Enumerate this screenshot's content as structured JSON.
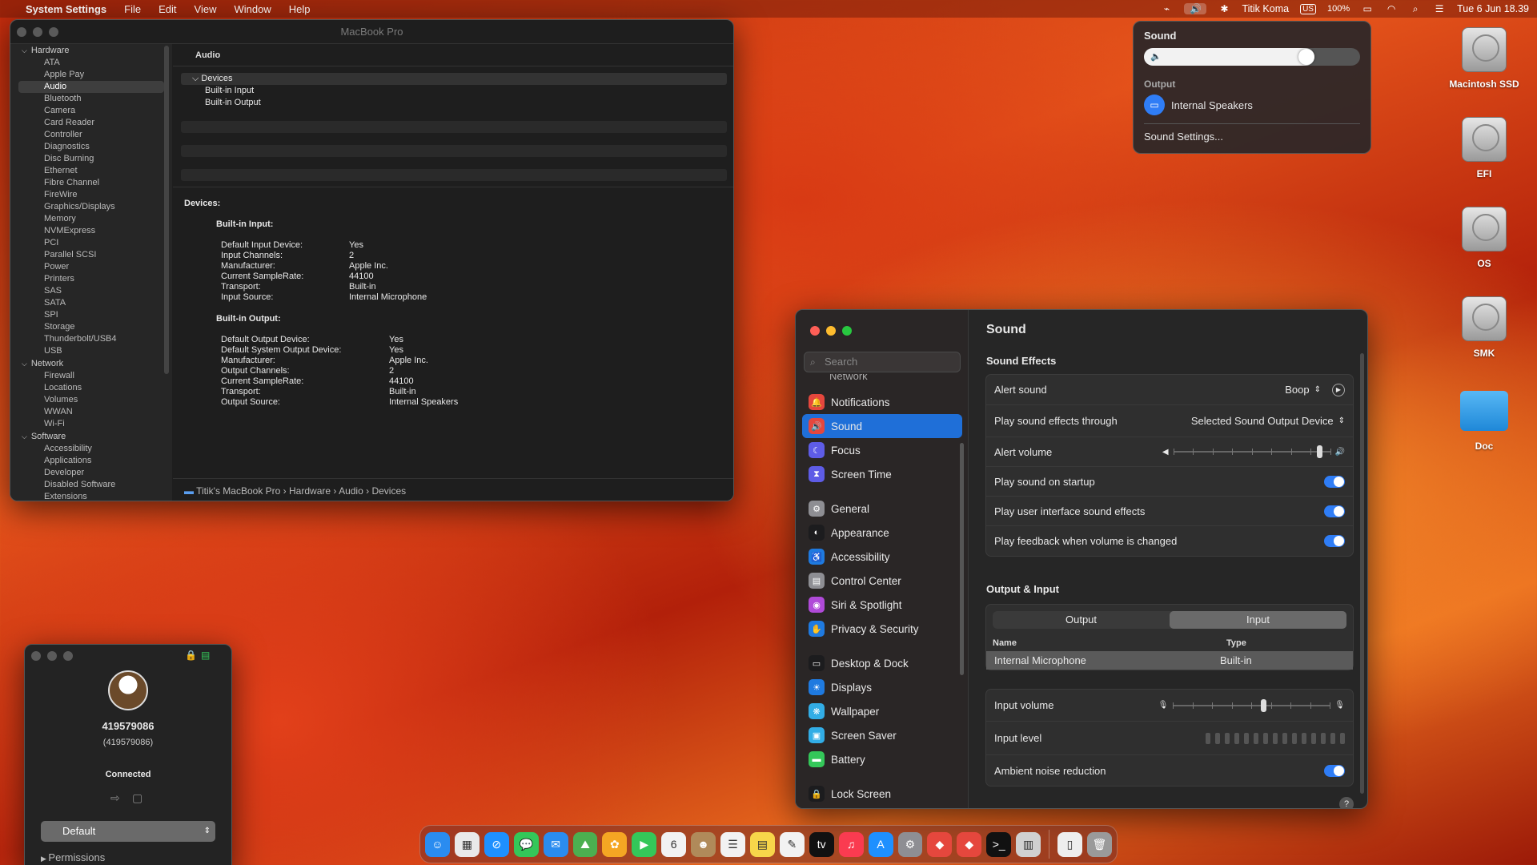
{
  "menubar": {
    "app": "System Settings",
    "menus": [
      "File",
      "Edit",
      "View",
      "Window",
      "Help"
    ],
    "user": "Titik Koma",
    "input": "US",
    "battery": "100%",
    "datetime": "Tue 6 Jun  18.39"
  },
  "sysinfo": {
    "title": "MacBook Pro",
    "column": "Audio",
    "sidebar": [
      {
        "type": "sec",
        "label": "Hardware"
      },
      {
        "type": "it",
        "label": "ATA"
      },
      {
        "type": "it",
        "label": "Apple Pay"
      },
      {
        "type": "it",
        "label": "Audio",
        "sel": true
      },
      {
        "type": "it",
        "label": "Bluetooth"
      },
      {
        "type": "it",
        "label": "Camera"
      },
      {
        "type": "it",
        "label": "Card Reader"
      },
      {
        "type": "it",
        "label": "Controller"
      },
      {
        "type": "it",
        "label": "Diagnostics"
      },
      {
        "type": "it",
        "label": "Disc Burning"
      },
      {
        "type": "it",
        "label": "Ethernet"
      },
      {
        "type": "it",
        "label": "Fibre Channel"
      },
      {
        "type": "it",
        "label": "FireWire"
      },
      {
        "type": "it",
        "label": "Graphics/Displays"
      },
      {
        "type": "it",
        "label": "Memory"
      },
      {
        "type": "it",
        "label": "NVMExpress"
      },
      {
        "type": "it",
        "label": "PCI"
      },
      {
        "type": "it",
        "label": "Parallel SCSI"
      },
      {
        "type": "it",
        "label": "Power"
      },
      {
        "type": "it",
        "label": "Printers"
      },
      {
        "type": "it",
        "label": "SAS"
      },
      {
        "type": "it",
        "label": "SATA"
      },
      {
        "type": "it",
        "label": "SPI"
      },
      {
        "type": "it",
        "label": "Storage"
      },
      {
        "type": "it",
        "label": "Thunderbolt/USB4"
      },
      {
        "type": "it",
        "label": "USB"
      },
      {
        "type": "sec",
        "label": "Network"
      },
      {
        "type": "it",
        "label": "Firewall"
      },
      {
        "type": "it",
        "label": "Locations"
      },
      {
        "type": "it",
        "label": "Volumes"
      },
      {
        "type": "it",
        "label": "WWAN"
      },
      {
        "type": "it",
        "label": "Wi-Fi"
      },
      {
        "type": "sec",
        "label": "Software"
      },
      {
        "type": "it",
        "label": "Accessibility"
      },
      {
        "type": "it",
        "label": "Applications"
      },
      {
        "type": "it",
        "label": "Developer"
      },
      {
        "type": "it",
        "label": "Disabled Software"
      },
      {
        "type": "it",
        "label": "Extensions"
      }
    ],
    "tree": {
      "root": "Devices",
      "children": [
        "Built-in Input",
        "Built-in Output"
      ]
    },
    "detail": {
      "heading": "Devices:",
      "input": {
        "title": "Built-in Input:",
        "rows": [
          [
            "Default Input Device:",
            "Yes"
          ],
          [
            "Input Channels:",
            "2"
          ],
          [
            "Manufacturer:",
            "Apple Inc."
          ],
          [
            "Current SampleRate:",
            "44100"
          ],
          [
            "Transport:",
            "Built-in"
          ],
          [
            "Input Source:",
            "Internal Microphone"
          ]
        ]
      },
      "output": {
        "title": "Built-in Output:",
        "rows": [
          [
            "Default Output Device:",
            "Yes"
          ],
          [
            "Default System Output Device:",
            "Yes"
          ],
          [
            "Manufacturer:",
            "Apple Inc."
          ],
          [
            "Output Channels:",
            "2"
          ],
          [
            "Current SampleRate:",
            "44100"
          ],
          [
            "Transport:",
            "Built-in"
          ],
          [
            "Output Source:",
            "Internal Speakers"
          ]
        ]
      }
    },
    "path": [
      "Titik's MacBook Pro",
      "Hardware",
      "Audio",
      "Devices"
    ]
  },
  "soundpop": {
    "title": "Sound",
    "volume": 0.79,
    "output_label": "Output",
    "device": "Internal Speakers",
    "settings": "Sound Settings..."
  },
  "desktop": [
    "Macintosh SSD",
    "EFI",
    "OS",
    "SMK",
    "Doc"
  ],
  "settings": {
    "search_placeholder": "Search",
    "partial": "Network",
    "nav": [
      {
        "label": "Notifications",
        "color": "#e5473d",
        "icon": "🔔"
      },
      {
        "label": "Sound",
        "color": "#e5473d",
        "icon": "🔊",
        "sel": true
      },
      {
        "label": "Focus",
        "color": "#5e5ce6",
        "icon": "☾"
      },
      {
        "label": "Screen Time",
        "color": "#5e5ce6",
        "icon": "⧗"
      },
      {
        "gap": true
      },
      {
        "label": "General",
        "color": "#8e8e93",
        "icon": "⚙"
      },
      {
        "label": "Appearance",
        "color": "#1c1c1e",
        "icon": "◐"
      },
      {
        "label": "Accessibility",
        "color": "#1f7ae0",
        "icon": "♿"
      },
      {
        "label": "Control Center",
        "color": "#8e8e93",
        "icon": "▤"
      },
      {
        "label": "Siri & Spotlight",
        "color": "#b04ad8",
        "icon": "◉"
      },
      {
        "label": "Privacy & Security",
        "color": "#1f7ae0",
        "icon": "✋"
      },
      {
        "gap": true
      },
      {
        "label": "Desktop & Dock",
        "color": "#1c1c1e",
        "icon": "▭"
      },
      {
        "label": "Displays",
        "color": "#1f7ae0",
        "icon": "☀"
      },
      {
        "label": "Wallpaper",
        "color": "#32ade6",
        "icon": "❋"
      },
      {
        "label": "Screen Saver",
        "color": "#32ade6",
        "icon": "▣"
      },
      {
        "label": "Battery",
        "color": "#34c759",
        "icon": "▬"
      },
      {
        "gap": true
      },
      {
        "label": "Lock Screen",
        "color": "#1c1c1e",
        "icon": "🔒"
      }
    ],
    "title": "Sound",
    "effects_title": "Sound Effects",
    "alert_sound_label": "Alert sound",
    "alert_sound": "Boop",
    "through_label": "Play sound effects through",
    "through": "Selected Sound Output Device",
    "alert_volume_label": "Alert volume",
    "alert_volume": 0.95,
    "startup": "Play sound on startup",
    "ui_sounds": "Play user interface sound effects",
    "feedback": "Play feedback when volume is changed",
    "io_title": "Output & Input",
    "seg": [
      "Output",
      "Input"
    ],
    "col_name": "Name",
    "col_type": "Type",
    "device": "Internal Microphone",
    "device_type": "Built-in",
    "input_volume_label": "Input volume",
    "input_volume": 0.58,
    "input_level_label": "Input level",
    "noise": "Ambient noise reduction",
    "help": "?"
  },
  "remote": {
    "name": "419579086",
    "id": "(419579086)",
    "status": "Connected",
    "profile": "Default",
    "permissions": "Permissions"
  },
  "dock": [
    {
      "c": "#2a8cf0",
      "i": "☺"
    },
    {
      "c": "#e9e9e9",
      "i": "▦"
    },
    {
      "c": "#1e90ff",
      "i": "⊘"
    },
    {
      "c": "#34c759",
      "i": "💬"
    },
    {
      "c": "#2a8cf0",
      "i": "✉"
    },
    {
      "c": "#4caf50",
      "i": "⛰"
    },
    {
      "c": "#f5a623",
      "i": "✿"
    },
    {
      "c": "#34c759",
      "i": "▶"
    },
    {
      "c": "#f2f2f2",
      "i": "6"
    },
    {
      "c": "#b08a5a",
      "i": "☻"
    },
    {
      "c": "#f2f2f2",
      "i": "☰"
    },
    {
      "c": "#f7d64a",
      "i": "▤"
    },
    {
      "c": "#f2f2f2",
      "i": "✎"
    },
    {
      "c": "#111",
      "i": "tv"
    },
    {
      "c": "#fa3b50",
      "i": "♫"
    },
    {
      "c": "#1e90ff",
      "i": "A"
    },
    {
      "c": "#8e8e93",
      "i": "⚙"
    },
    {
      "c": "#e5473d",
      "i": "◆"
    },
    {
      "c": "#e5473d",
      "i": "◆"
    },
    {
      "c": "#111",
      "i": ">_"
    },
    {
      "c": "#d0d0d0",
      "i": "▥"
    },
    {
      "sep": true
    },
    {
      "c": "#eee",
      "i": "▯"
    },
    {
      "c": "#9a9a9a",
      "i": "🗑"
    }
  ]
}
